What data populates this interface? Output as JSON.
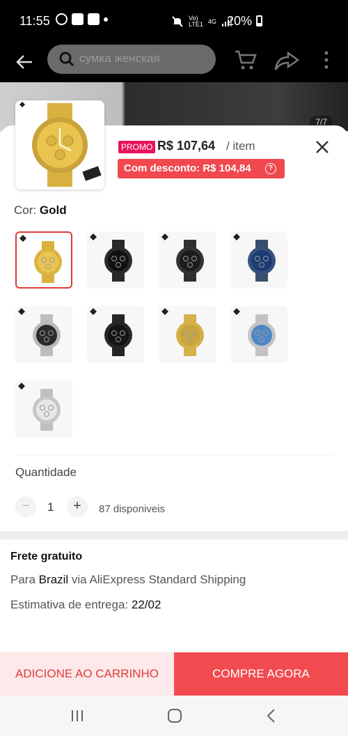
{
  "status_bar": {
    "time": "11:55",
    "net_top": "Vo)",
    "net_bottom": "LTE1",
    "net_type": "4G",
    "battery_percent": "20%"
  },
  "header": {
    "search_placeholder": "сумка женская"
  },
  "gallery": {
    "badge": "7/7"
  },
  "product": {
    "promo_tag": "PROMO",
    "price": "R$ 107,64",
    "unit": "/ item",
    "discount_label": "Com desconto: R$ 104,84",
    "discount_info": "?",
    "color_label": "Cor:",
    "color_value": "Gold",
    "color_options": [
      {
        "name": "gold",
        "case": "#d9b443",
        "dial": "#e9c44e",
        "band": "#d8b140",
        "selected": true
      },
      {
        "name": "black-rose",
        "case": "#2b2b2b",
        "dial": "#111111",
        "band": "#2a2a2a",
        "selected": false
      },
      {
        "name": "black",
        "case": "#333333",
        "dial": "#1c1c1c",
        "band": "#303030",
        "selected": false
      },
      {
        "name": "blue",
        "case": "#35507a",
        "dial": "#1c3b74",
        "band": "#3a4f6f",
        "selected": false
      },
      {
        "name": "silver-black",
        "case": "#b9b9b9",
        "dial": "#2a2a2a",
        "band": "#bdbdbd",
        "selected": false
      },
      {
        "name": "all-black",
        "case": "#262626",
        "dial": "#141414",
        "band": "#262626",
        "selected": false
      },
      {
        "name": "gold-2",
        "case": "#d4b146",
        "dial": "#caa53e",
        "band": "#d6b24a",
        "selected": false
      },
      {
        "name": "silver-blue",
        "case": "#c4c4c4",
        "dial": "#4f86c6",
        "band": "#c2c2c2",
        "selected": false
      },
      {
        "name": "silver-white",
        "case": "#c6c6c6",
        "dial": "#e7e7e7",
        "band": "#c0c0c0",
        "selected": false
      }
    ]
  },
  "quantity": {
    "label": "Quantidade",
    "minus": "−",
    "value": "1",
    "plus": "+",
    "available": "87 disponiveis"
  },
  "shipping": {
    "title": "Frete gratuito",
    "line_prefix": "Para",
    "line_country": "Brazil",
    "line_suffix": "via AliExpress Standard Shipping",
    "eta_label": "Estimativa de entrega:",
    "eta_date": "22/02"
  },
  "actions": {
    "add_to_cart": "ADICIONE AO CARRINHO",
    "buy_now": "COMPRE AGORA"
  },
  "colors": {
    "accent": "#f24b4f",
    "promo": "#e8145a",
    "discount_bg": "#f0484e",
    "cart_bg": "#fde9e9"
  }
}
